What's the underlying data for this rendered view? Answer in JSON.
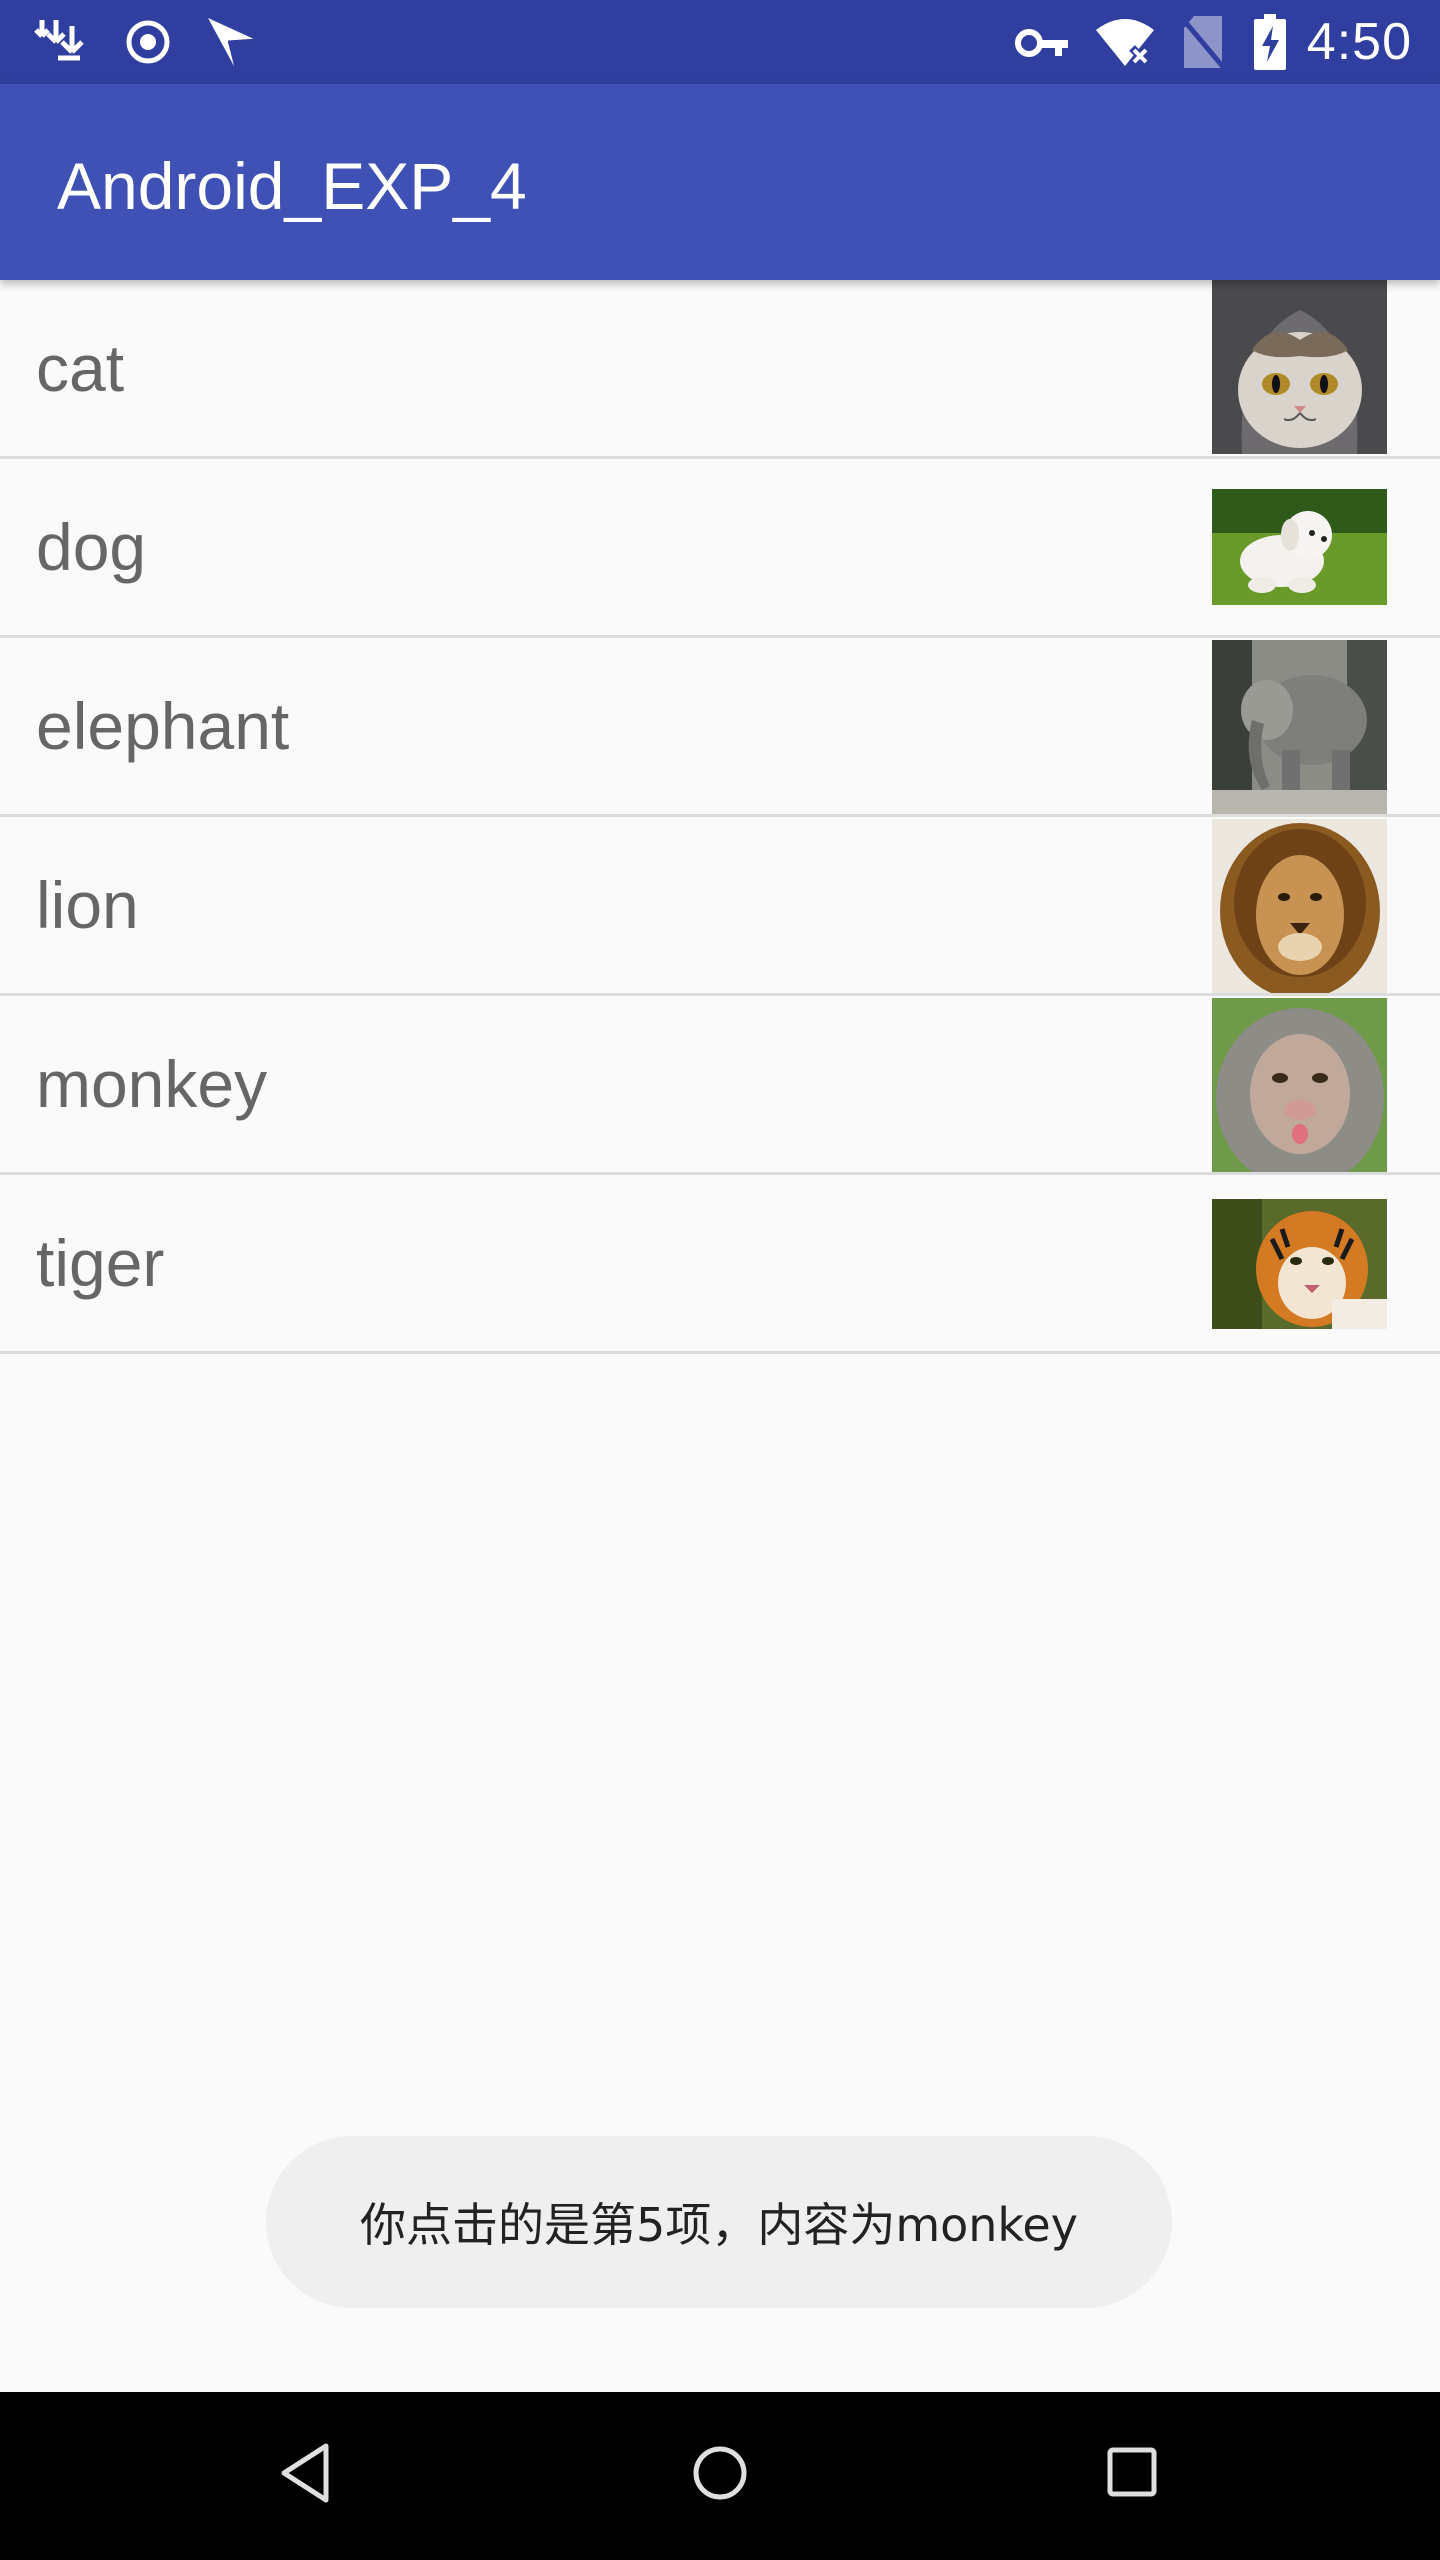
{
  "status_bar": {
    "time": "4:50",
    "left_icons": [
      "download-notification-icon",
      "target-icon",
      "send-icon"
    ],
    "right_icons": [
      "vpn-key-icon",
      "wifi-off-icon",
      "no-sim-icon",
      "battery-charging-icon"
    ],
    "color": "#303f9f"
  },
  "app_bar": {
    "title": "Android_EXP_4",
    "color": "#3f51b5"
  },
  "list": {
    "items": [
      {
        "label": "cat",
        "image": "cat-photo"
      },
      {
        "label": "dog",
        "image": "dog-photo"
      },
      {
        "label": "elephant",
        "image": "elephant-photo"
      },
      {
        "label": "lion",
        "image": "lion-photo"
      },
      {
        "label": "monkey",
        "image": "monkey-photo"
      },
      {
        "label": "tiger",
        "image": "tiger-photo"
      }
    ]
  },
  "toast": {
    "message": "你点击的是第5项，内容为monkey"
  },
  "nav_bar": {
    "buttons": [
      "back-icon",
      "home-icon",
      "recents-icon"
    ]
  }
}
